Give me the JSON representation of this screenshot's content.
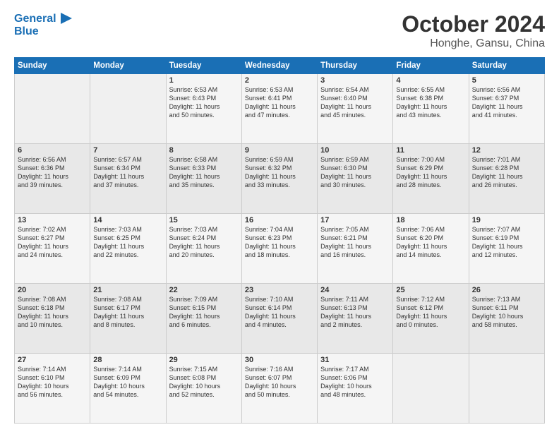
{
  "logo": {
    "line1": "General",
    "line2": "Blue",
    "icon": "▶"
  },
  "title": "October 2024",
  "location": "Honghe, Gansu, China",
  "days_of_week": [
    "Sunday",
    "Monday",
    "Tuesday",
    "Wednesday",
    "Thursday",
    "Friday",
    "Saturday"
  ],
  "weeks": [
    [
      {
        "day": "",
        "info": ""
      },
      {
        "day": "",
        "info": ""
      },
      {
        "day": "1",
        "info": "Sunrise: 6:53 AM\nSunset: 6:43 PM\nDaylight: 11 hours\nand 50 minutes."
      },
      {
        "day": "2",
        "info": "Sunrise: 6:53 AM\nSunset: 6:41 PM\nDaylight: 11 hours\nand 47 minutes."
      },
      {
        "day": "3",
        "info": "Sunrise: 6:54 AM\nSunset: 6:40 PM\nDaylight: 11 hours\nand 45 minutes."
      },
      {
        "day": "4",
        "info": "Sunrise: 6:55 AM\nSunset: 6:38 PM\nDaylight: 11 hours\nand 43 minutes."
      },
      {
        "day": "5",
        "info": "Sunrise: 6:56 AM\nSunset: 6:37 PM\nDaylight: 11 hours\nand 41 minutes."
      }
    ],
    [
      {
        "day": "6",
        "info": "Sunrise: 6:56 AM\nSunset: 6:36 PM\nDaylight: 11 hours\nand 39 minutes."
      },
      {
        "day": "7",
        "info": "Sunrise: 6:57 AM\nSunset: 6:34 PM\nDaylight: 11 hours\nand 37 minutes."
      },
      {
        "day": "8",
        "info": "Sunrise: 6:58 AM\nSunset: 6:33 PM\nDaylight: 11 hours\nand 35 minutes."
      },
      {
        "day": "9",
        "info": "Sunrise: 6:59 AM\nSunset: 6:32 PM\nDaylight: 11 hours\nand 33 minutes."
      },
      {
        "day": "10",
        "info": "Sunrise: 6:59 AM\nSunset: 6:30 PM\nDaylight: 11 hours\nand 30 minutes."
      },
      {
        "day": "11",
        "info": "Sunrise: 7:00 AM\nSunset: 6:29 PM\nDaylight: 11 hours\nand 28 minutes."
      },
      {
        "day": "12",
        "info": "Sunrise: 7:01 AM\nSunset: 6:28 PM\nDaylight: 11 hours\nand 26 minutes."
      }
    ],
    [
      {
        "day": "13",
        "info": "Sunrise: 7:02 AM\nSunset: 6:27 PM\nDaylight: 11 hours\nand 24 minutes."
      },
      {
        "day": "14",
        "info": "Sunrise: 7:03 AM\nSunset: 6:25 PM\nDaylight: 11 hours\nand 22 minutes."
      },
      {
        "day": "15",
        "info": "Sunrise: 7:03 AM\nSunset: 6:24 PM\nDaylight: 11 hours\nand 20 minutes."
      },
      {
        "day": "16",
        "info": "Sunrise: 7:04 AM\nSunset: 6:23 PM\nDaylight: 11 hours\nand 18 minutes."
      },
      {
        "day": "17",
        "info": "Sunrise: 7:05 AM\nSunset: 6:21 PM\nDaylight: 11 hours\nand 16 minutes."
      },
      {
        "day": "18",
        "info": "Sunrise: 7:06 AM\nSunset: 6:20 PM\nDaylight: 11 hours\nand 14 minutes."
      },
      {
        "day": "19",
        "info": "Sunrise: 7:07 AM\nSunset: 6:19 PM\nDaylight: 11 hours\nand 12 minutes."
      }
    ],
    [
      {
        "day": "20",
        "info": "Sunrise: 7:08 AM\nSunset: 6:18 PM\nDaylight: 11 hours\nand 10 minutes."
      },
      {
        "day": "21",
        "info": "Sunrise: 7:08 AM\nSunset: 6:17 PM\nDaylight: 11 hours\nand 8 minutes."
      },
      {
        "day": "22",
        "info": "Sunrise: 7:09 AM\nSunset: 6:15 PM\nDaylight: 11 hours\nand 6 minutes."
      },
      {
        "day": "23",
        "info": "Sunrise: 7:10 AM\nSunset: 6:14 PM\nDaylight: 11 hours\nand 4 minutes."
      },
      {
        "day": "24",
        "info": "Sunrise: 7:11 AM\nSunset: 6:13 PM\nDaylight: 11 hours\nand 2 minutes."
      },
      {
        "day": "25",
        "info": "Sunrise: 7:12 AM\nSunset: 6:12 PM\nDaylight: 11 hours\nand 0 minutes."
      },
      {
        "day": "26",
        "info": "Sunrise: 7:13 AM\nSunset: 6:11 PM\nDaylight: 10 hours\nand 58 minutes."
      }
    ],
    [
      {
        "day": "27",
        "info": "Sunrise: 7:14 AM\nSunset: 6:10 PM\nDaylight: 10 hours\nand 56 minutes."
      },
      {
        "day": "28",
        "info": "Sunrise: 7:14 AM\nSunset: 6:09 PM\nDaylight: 10 hours\nand 54 minutes."
      },
      {
        "day": "29",
        "info": "Sunrise: 7:15 AM\nSunset: 6:08 PM\nDaylight: 10 hours\nand 52 minutes."
      },
      {
        "day": "30",
        "info": "Sunrise: 7:16 AM\nSunset: 6:07 PM\nDaylight: 10 hours\nand 50 minutes."
      },
      {
        "day": "31",
        "info": "Sunrise: 7:17 AM\nSunset: 6:06 PM\nDaylight: 10 hours\nand 48 minutes."
      },
      {
        "day": "",
        "info": ""
      },
      {
        "day": "",
        "info": ""
      }
    ]
  ]
}
